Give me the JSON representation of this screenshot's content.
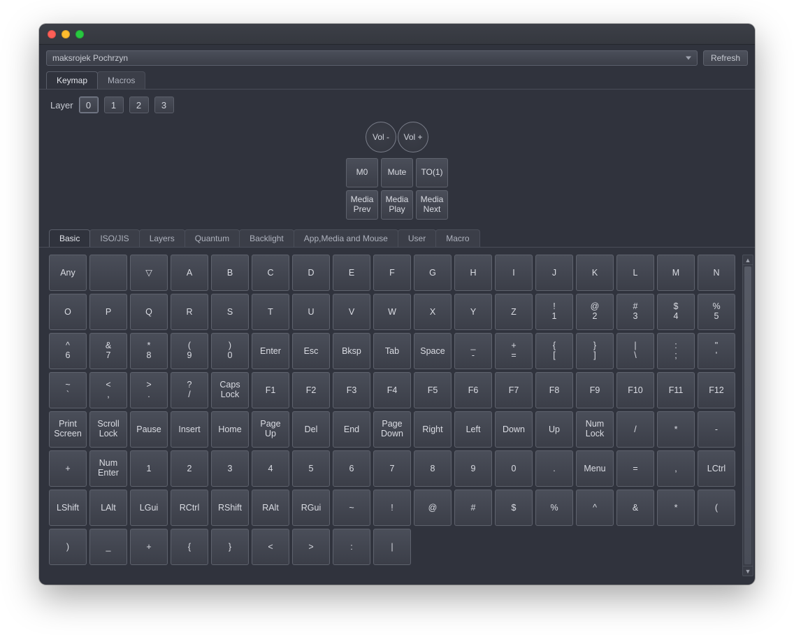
{
  "device_name": "maksrojek Pochrzyn",
  "refresh_label": "Refresh",
  "main_tabs": [
    "Keymap",
    "Macros"
  ],
  "main_tab_active": 0,
  "layer_label": "Layer",
  "layers": [
    "0",
    "1",
    "2",
    "3"
  ],
  "layer_active": 0,
  "encoders": [
    "Vol -",
    "Vol +"
  ],
  "macropad_keys": [
    "M0",
    "Mute",
    "TO(1)",
    "Media\nPrev",
    "Media\nPlay",
    "Media\nNext"
  ],
  "category_tabs": [
    "Basic",
    "ISO/JIS",
    "Layers",
    "Quantum",
    "Backlight",
    "App,Media and Mouse",
    "User",
    "Macro"
  ],
  "category_active": 0,
  "palette_rows": [
    [
      "Any",
      "",
      "▽",
      "A",
      "B",
      "C",
      "D",
      "E",
      "F",
      "G",
      "H",
      "I",
      "J",
      "K",
      "L",
      "M"
    ],
    [
      "N",
      "O",
      "P",
      "Q",
      "R",
      "S",
      "T",
      "U",
      "V",
      "W",
      "X",
      "Y",
      "Z",
      "!\n1",
      "@\n2",
      "#\n3"
    ],
    [
      "$\n4",
      "%\n5",
      "^\n6",
      "&\n7",
      "*\n8",
      "(\n9",
      ")\n0",
      "Enter",
      "Esc",
      "Bksp",
      "Tab",
      "Space",
      "_\n-",
      "+\n=",
      "{\n[",
      "}\n]"
    ],
    [
      "|\n\\",
      ":\n;",
      "\"\n'",
      "~\n`",
      "<\n,",
      ">\n.",
      "?\n/",
      "Caps\nLock",
      "F1",
      "F2",
      "F3",
      "F4",
      "F5",
      "F6",
      "F7",
      "F8"
    ],
    [
      "F9",
      "F10",
      "F11",
      "F12",
      "Print\nScreen",
      "Scroll\nLock",
      "Pause",
      "Insert",
      "Home",
      "Page\nUp",
      "Del",
      "End",
      "Page\nDown",
      "Right",
      "Left",
      "Down"
    ],
    [
      "Up",
      "Num\nLock",
      "/",
      "*",
      "-",
      "+",
      "Num\nEnter",
      "1",
      "2",
      "3",
      "4",
      "5",
      "6",
      "7",
      "8",
      "9"
    ],
    [
      "0",
      ".",
      "Menu",
      "=",
      ",",
      "LCtrl",
      "LShift",
      "LAlt",
      "LGui",
      "RCtrl",
      "RShift",
      "RAlt",
      "RGui",
      "~",
      "!",
      "@"
    ],
    [
      "#",
      "$",
      "%",
      "^",
      "&",
      "*",
      "(",
      ")",
      "_",
      "+",
      "{",
      "}",
      "<",
      ">",
      ":",
      "|"
    ]
  ]
}
